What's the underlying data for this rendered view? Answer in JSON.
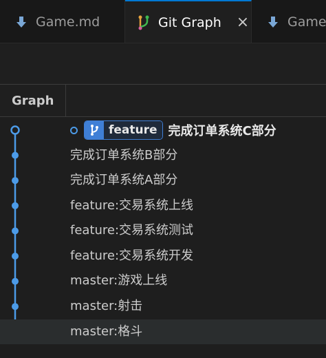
{
  "tabs": [
    {
      "label": "Game.md",
      "icon": "markdown-download-icon",
      "active": false
    },
    {
      "label": "Git Graph",
      "icon": "git-graph-icon",
      "active": true
    },
    {
      "label": "Game.",
      "icon": "markdown-download-icon",
      "active": false
    }
  ],
  "close_glyph": "×",
  "header": {
    "graph_label": "Graph"
  },
  "head_branch": "feature",
  "commits": [
    {
      "message": "完成订单系统C部分",
      "head": true
    },
    {
      "message": "完成订单系统B部分"
    },
    {
      "message": "完成订单系统A部分"
    },
    {
      "message": "feature:交易系统上线"
    },
    {
      "message": "feature:交易系统测试"
    },
    {
      "message": "feature:交易系统开发"
    },
    {
      "message": "master:游戏上线"
    },
    {
      "message": "master:射击"
    },
    {
      "message": "master:格斗",
      "selected": true
    }
  ],
  "colors": {
    "graph_line": "#4c9be8",
    "badge": "#3f7fd6",
    "tab_accent": "#0078d4"
  }
}
